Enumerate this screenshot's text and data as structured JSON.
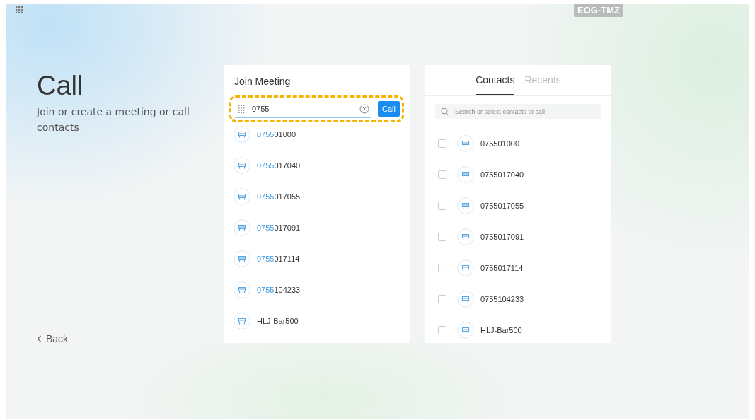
{
  "device_label": "EOG-TMZ",
  "title": "Call",
  "subtitle": "Join or create a meeting or call contacts",
  "back": "Back",
  "join_meeting": {
    "heading": "Join Meeting",
    "highlighted": true,
    "field_value": "0755",
    "call_button": "Call",
    "results": [
      {
        "match": "0755",
        "rest": "01000"
      },
      {
        "match": "0755",
        "rest": "017040"
      },
      {
        "match": "0755",
        "rest": "017055"
      },
      {
        "match": "0755",
        "rest": "017091"
      },
      {
        "match": "0755",
        "rest": "017114"
      },
      {
        "match": "0755",
        "rest": "104233"
      },
      {
        "rest": "HLJ-Bar500"
      }
    ]
  },
  "contacts_panel": {
    "tabs": [
      {
        "label": "Contacts",
        "selected": true
      },
      {
        "label": "Recents",
        "selected": false
      }
    ],
    "search": {
      "placeholder": "Search or select contacts to call"
    },
    "contacts": [
      {
        "name": "075501000",
        "checked": false
      },
      {
        "name": "0755017040",
        "checked": false
      },
      {
        "name": "0755017055",
        "checked": false
      },
      {
        "name": "0755017091",
        "checked": false
      },
      {
        "name": "0755017114",
        "checked": false
      },
      {
        "name": "0755104233",
        "checked": false
      },
      {
        "name": "HLJ-Bar500",
        "checked": false
      }
    ]
  }
}
